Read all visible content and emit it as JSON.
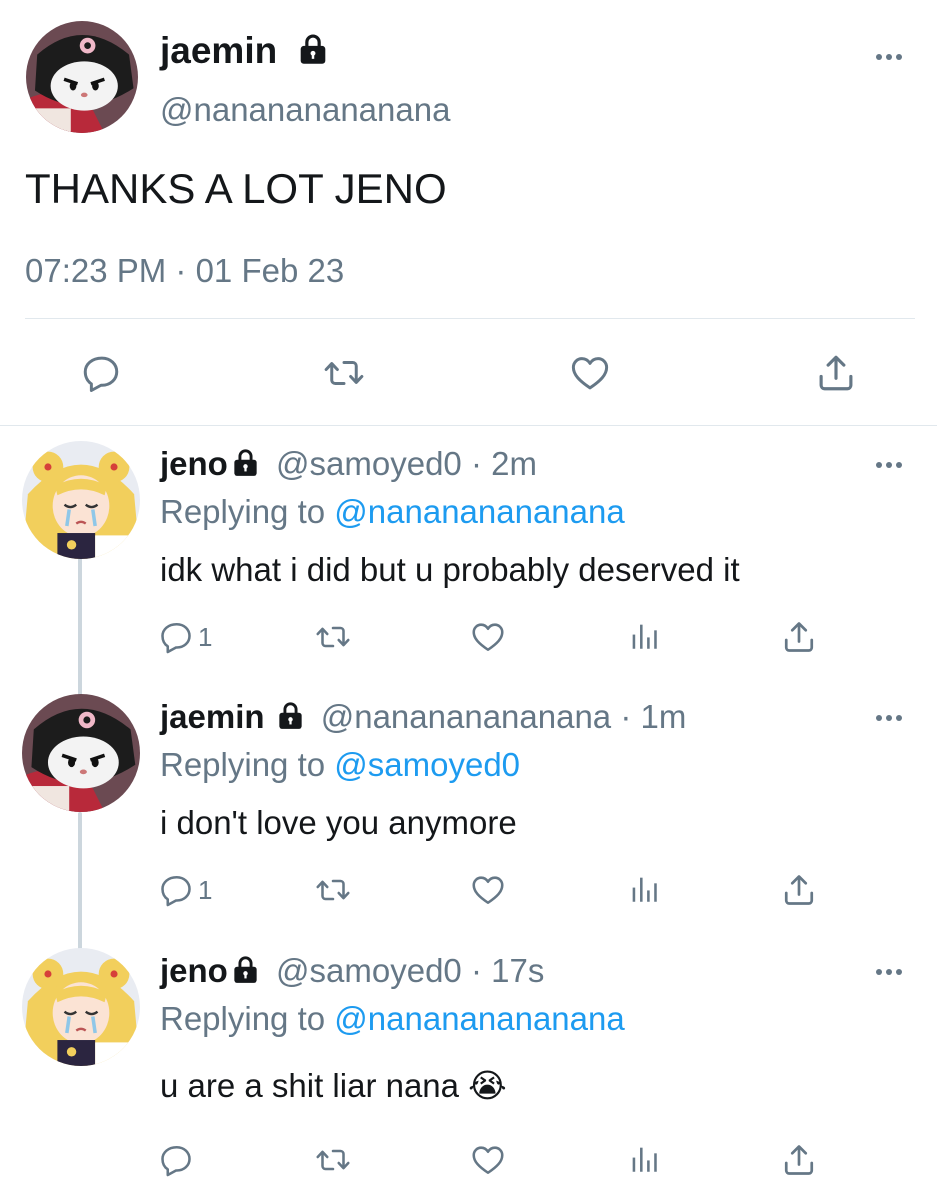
{
  "colors": {
    "accent": "#1d9bf0",
    "muted": "#657786",
    "divider": "#e1e8ed"
  },
  "main_tweet": {
    "name": "jaemin",
    "handle": "@nanananananana",
    "text": "THANKS A LOT JENO",
    "timestamp": "07:23 PM · 01 Feb 23",
    "actions": [
      "reply-icon",
      "retweet-icon",
      "like-icon",
      "share-icon"
    ]
  },
  "replies": [
    {
      "name": "jeno",
      "handle": "@samoyed0",
      "time": "2m",
      "replying_prefix": "Replying to",
      "replying_to": "@nanananananana",
      "text": "idk what i did but u probably deserved it",
      "reply_count": "1"
    },
    {
      "name": "jaemin",
      "handle": "@nanananananana",
      "time": "1m",
      "replying_prefix": "Replying to",
      "replying_to": "@samoyed0",
      "text": "i don't love you anymore",
      "reply_count": "1"
    },
    {
      "name": "jeno",
      "handle": "@samoyed0",
      "time": "17s",
      "replying_prefix": "Replying to",
      "replying_to": "@nanananananana",
      "text": "u are a shit liar nana 😭",
      "reply_count": ""
    }
  ]
}
